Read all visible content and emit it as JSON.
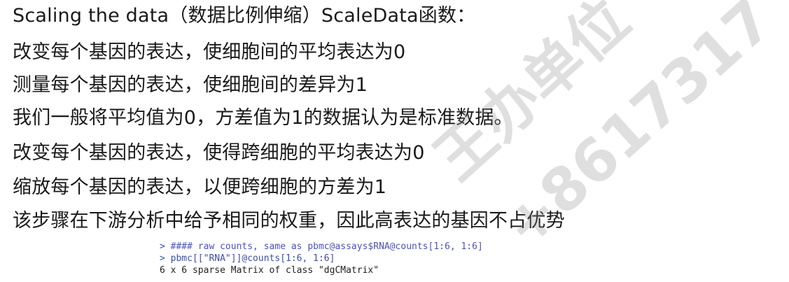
{
  "lines": [
    "Scaling the data（数据比例伸缩）ScaleData函数：",
    "改变每个基因的表达，使细胞间的平均表达为0",
    "测量每个基因的表达，使细胞间的差异为1",
    "我们一般将平均值为0，方差值为1的数据认为是标准数据。",
    "改变每个基因的表达，使得跨细胞的平均表达为0",
    "缩放每个基因的表达，以便跨细胞的方差为1",
    "该步骤在下游分析中给予相同的权重，因此高表达的基因不占优势"
  ],
  "code": {
    "prompt": ">",
    "comment": "#### raw counts, same as pbmc@assays$RNA@counts[1:6, 1:6]",
    "command": "pbmc[[\"RNA\"]]@counts[1:6, 1:6]",
    "output": "6 x 6 sparse Matrix of class \"dgCMatrix\""
  },
  "watermark": {
    "line1": "王办单位",
    "line2": "+8617317"
  }
}
